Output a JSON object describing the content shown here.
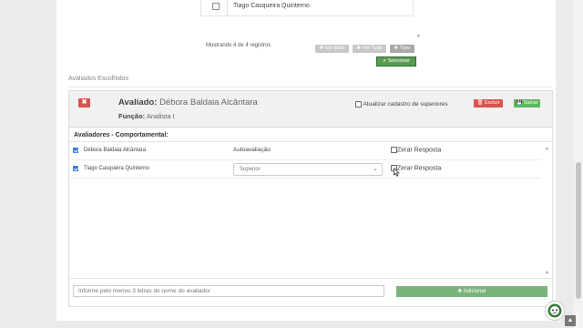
{
  "top_table": {
    "row_name": "Tiago Casqueira Quinterno"
  },
  "pagination": {
    "count_text": "Mostrando 4 de 4 registros",
    "ver_mais": "✚ Ver Mais",
    "ver_tudo": "✚ Ver Tudo",
    "topo": "✚ Topo",
    "selecionar": "✔ Selecionar"
  },
  "section": {
    "title": "Avaliados Escolhidos"
  },
  "evaluated": {
    "remove_label": "✖",
    "label": "Avaliado:",
    "name": "Débora Baldaia Alcântara",
    "role_label": "Função:",
    "role": "Analista I",
    "update_label": "Atualizar cadastro de superiores",
    "delete_label": "🗑 Excluir",
    "save_label": "💾 Salvar"
  },
  "evaluators": {
    "title": "Avaliadores - Comportamental:",
    "rows": [
      {
        "name": "Débora Baldaia Alcântara",
        "type": "Autoavaliação",
        "reset": "Zerar Resposta"
      },
      {
        "name": "Tiago Casqueira Quinterno",
        "type": "Superior",
        "reset": "Zerar Resposta"
      }
    ]
  },
  "footer": {
    "input_placeholder": "Informe pelo menos 3 letras do nome do avaliador",
    "add_label": "✚ Adicionar"
  },
  "colors": {
    "accent": "#3b77d9",
    "danger": "#d9534f",
    "success": "#5cb85c"
  }
}
